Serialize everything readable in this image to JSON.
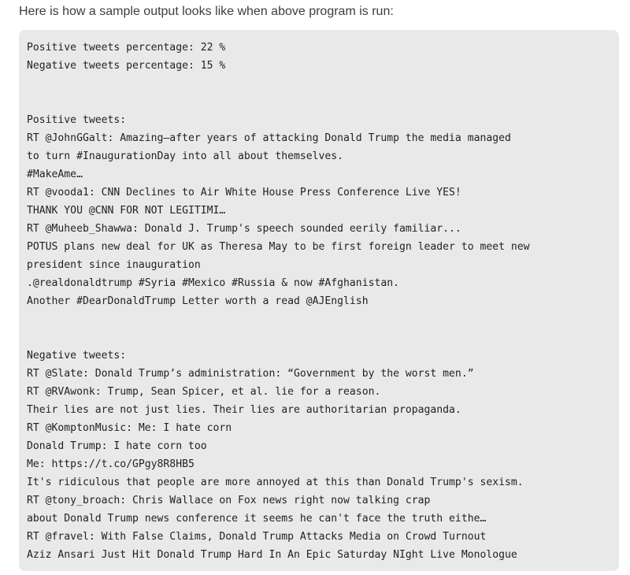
{
  "intro_text": "Here is how a sample output looks like when above program is run:",
  "output_lines": [
    "Positive tweets percentage: 22 %",
    "Negative tweets percentage: 15 %",
    "",
    "",
    "Positive tweets:",
    "RT @JohnGGalt: Amazing—after years of attacking Donald Trump the media managed",
    "to turn #InaugurationDay into all about themselves.",
    "#MakeAme…",
    "RT @vooda1: CNN Declines to Air White House Press Conference Live YES!",
    "THANK YOU @CNN FOR NOT LEGITIMI…",
    "RT @Muheeb_Shawwa: Donald J. Trump's speech sounded eerily familiar...",
    "POTUS plans new deal for UK as Theresa May to be first foreign leader to meet new",
    "president since inauguration",
    ".@realdonaldtrump #Syria #Mexico #Russia & now #Afghanistan.",
    "Another #DearDonaldTrump Letter worth a read @AJEnglish",
    "",
    "",
    "Negative tweets:",
    "RT @Slate: Donald Trump’s administration: “Government by the worst men.”",
    "RT @RVAwonk: Trump, Sean Spicer, et al. lie for a reason.",
    "Their lies are not just lies. Their lies are authoritarian propaganda.",
    "RT @KomptonMusic: Me: I hate corn",
    "Donald Trump: I hate corn too",
    "Me: https://t.co/GPgy8R8HB5",
    "It's ridiculous that people are more annoyed at this than Donald Trump's sexism.",
    "RT @tony_broach: Chris Wallace on Fox news right now talking crap",
    "about Donald Trump news conference it seems he can't face the truth eithe…",
    "RT @fravel: With False Claims, Donald Trump Attacks Media on Crowd Turnout",
    "Aziz Ansari Just Hit Donald Trump Hard In An Epic Saturday NIght Live Monologue"
  ]
}
